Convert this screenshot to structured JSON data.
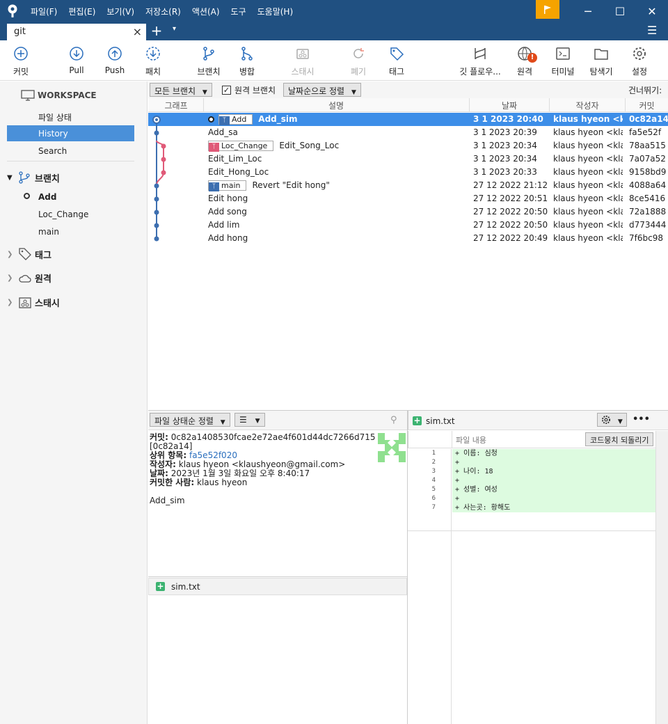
{
  "titlebar": {
    "menu": [
      "파일(F)",
      "편집(E)",
      "보기(V)",
      "저장소(R)",
      "액션(A)",
      "도구",
      "도움말(H)"
    ],
    "minimize": "─",
    "maximize": "☐",
    "close": "✕"
  },
  "tabs": {
    "current": "git",
    "close": "×",
    "new": "+",
    "dropdown": "▾",
    "menu": "☰"
  },
  "toolbar": {
    "commit": "커밋",
    "pull": "Pull",
    "push": "Push",
    "fetch": "패치",
    "branch": "브랜치",
    "merge": "병합",
    "stash": "스태시",
    "discard": "폐기",
    "tag": "태그",
    "gitflow": "깃 플로우...",
    "remote": "원격",
    "terminal": "터미널",
    "explorer": "탐색기",
    "settings": "설정"
  },
  "sidebar": {
    "workspace": "WORKSPACE",
    "workspace_items": [
      "파일 상태",
      "History",
      "Search"
    ],
    "branches_title": "브랜치",
    "branches": [
      "Add",
      "Loc_Change",
      "main"
    ],
    "tags_title": "태그",
    "remotes_title": "원격",
    "stashes_title": "스태시"
  },
  "filters": {
    "all_branches": "모든 브랜치",
    "remote_branches": "원격 브랜치",
    "sort": "날짜순으로 정렬",
    "skip": "건너뛰기:"
  },
  "log_header": {
    "graph": "그래프",
    "desc": "설명",
    "date": "날짜",
    "author": "작성자",
    "commit": "커밋"
  },
  "commits": [
    {
      "desc": "Add_sim",
      "label": "Add",
      "label_color": "#3d6fb0",
      "date": "3 1 2023 20:40",
      "author": "klaus hyeon <kla",
      "hash": "0c82a14"
    },
    {
      "desc": "Add_sa",
      "label": "",
      "date": "3 1 2023 20:39",
      "author": "klaus hyeon <klau",
      "hash": "fa5e52f"
    },
    {
      "desc": "Edit_Song_Loc",
      "label": "Loc_Change",
      "label_color": "#e05a78",
      "date": "3 1 2023 20:34",
      "author": "klaus hyeon <klau",
      "hash": "78aa515"
    },
    {
      "desc": "Edit_Lim_Loc",
      "label": "",
      "date": "3 1 2023 20:34",
      "author": "klaus hyeon <klau",
      "hash": "7a07a52"
    },
    {
      "desc": "Edit_Hong_Loc",
      "label": "",
      "date": "3 1 2023 20:33",
      "author": "klaus hyeon <klau",
      "hash": "9158bd9"
    },
    {
      "desc": "Revert \"Edit hong\"",
      "label": "main",
      "label_color": "#3d6fb0",
      "date": "27 12 2022 21:12",
      "author": "klaus hyeon <klau",
      "hash": "4088a64"
    },
    {
      "desc": "Edit hong",
      "label": "",
      "date": "27 12 2022 20:51",
      "author": "klaus hyeon <klau",
      "hash": "8ce5416"
    },
    {
      "desc": "Add song",
      "label": "",
      "date": "27 12 2022 20:50",
      "author": "klaus hyeon <klau",
      "hash": "72a1888"
    },
    {
      "desc": "Add lim",
      "label": "",
      "date": "27 12 2022 20:50",
      "author": "klaus hyeon <klau",
      "hash": "d773444"
    },
    {
      "desc": "Add hong",
      "label": "",
      "date": "27 12 2022 20:49",
      "author": "klaus hyeon <klau",
      "hash": "7f6bc98"
    }
  ],
  "bottom_left": {
    "sort": "파일 상태순 정렬",
    "commit_key": "커밋:",
    "commit_full": "0c82a1408530fcae2e72ae4f601d44dc7266d715",
    "commit_short": "[0c82a14]",
    "parent_key": "상위 항목:",
    "parent": "fa5e52f020",
    "author_key": "작성자:",
    "author": "klaus hyeon <klaushyeon@gmail.com>",
    "date_key": "날짜:",
    "date": "2023년 1월 3일 화요일 오후 8:40:17",
    "committer_key": "커밋한 사람:",
    "committer": "klaus hyeon",
    "message": "Add_sim",
    "file": "sim.txt"
  },
  "diff": {
    "file": "sim.txt",
    "content_label": "파일 내용",
    "revert_button": "코드뭉치 되돌리기",
    "more": "•••",
    "lines": [
      {
        "n": "1",
        "text": "+ 이름: 심청"
      },
      {
        "n": "2",
        "text": "+"
      },
      {
        "n": "3",
        "text": "+ 나이: 18"
      },
      {
        "n": "4",
        "text": "+"
      },
      {
        "n": "5",
        "text": "+ 성별: 여성"
      },
      {
        "n": "6",
        "text": "+"
      },
      {
        "n": "7",
        "text": "+ 사는곳: 황해도"
      }
    ]
  }
}
